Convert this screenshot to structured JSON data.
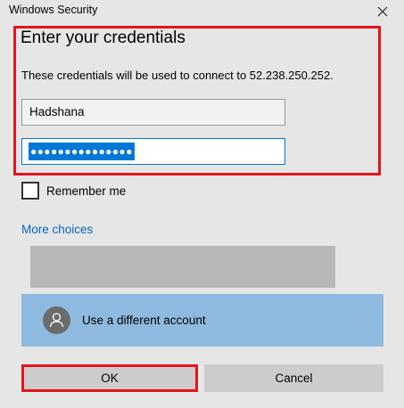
{
  "window": {
    "title": "Windows Security"
  },
  "dialog": {
    "heading": "Enter your credentials",
    "description": "These credentials will be used to connect to 52.238.250.252."
  },
  "fields": {
    "username_value": "Hadshana",
    "password_masked": "●●●●●●●●●●●●●●●"
  },
  "options": {
    "remember_label": "Remember me",
    "remember_checked": false,
    "more_choices_label": "More choices"
  },
  "accounts": {
    "different_account_label": "Use a different account"
  },
  "buttons": {
    "ok_label": "OK",
    "cancel_label": "Cancel"
  },
  "colors": {
    "highlight": "#e4141b",
    "link": "#0067c0",
    "selection": "#0078d7",
    "account_tile": "#8fbae0"
  }
}
